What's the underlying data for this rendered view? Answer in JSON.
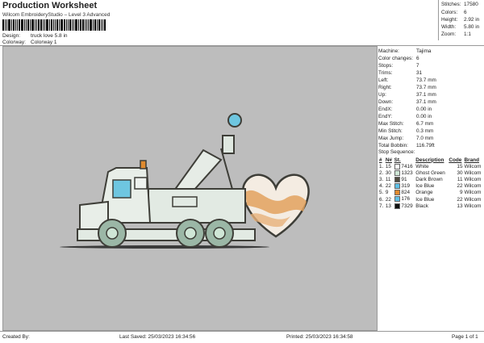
{
  "header": {
    "title": "Production Worksheet",
    "subtitle": "Wilcom EmbroideryStudio – Level 3 Advanced",
    "design_label": "Design:",
    "design_value": "truck love 5.8 in",
    "colorway_label": "Colorway:",
    "colorway_value": "Colorway 1"
  },
  "stats": {
    "stitches_label": "Stitches:",
    "stitches": "17580",
    "colors_label": "Colors:",
    "colors": "6",
    "height_label": "Height:",
    "height": "2.92 in",
    "width_label": "Width:",
    "width": "5.80 in",
    "zoom_label": "Zoom:",
    "zoom": "1:1"
  },
  "machine_info": [
    {
      "k": "Machine:",
      "v": "Tajima"
    },
    {
      "k": "Color changes:",
      "v": "6"
    },
    {
      "k": "Stops:",
      "v": "7"
    },
    {
      "k": "Trims:",
      "v": "31"
    },
    {
      "k": "Left:",
      "v": "73.7 mm"
    },
    {
      "k": "Right:",
      "v": "73.7 mm"
    },
    {
      "k": "Up:",
      "v": "37.1 mm"
    },
    {
      "k": "Down:",
      "v": "37.1 mm"
    },
    {
      "k": "EndX:",
      "v": "0.00 in"
    },
    {
      "k": "EndY:",
      "v": "0.00 in"
    },
    {
      "k": "Max Stitch:",
      "v": "6.7 mm"
    },
    {
      "k": "Min Stitch:",
      "v": "0.3 mm"
    },
    {
      "k": "Max Jump:",
      "v": "7.0 mm"
    },
    {
      "k": "Total Bobbin:",
      "v": "116.79ft"
    }
  ],
  "stop_sequence": {
    "title": "Stop Sequence:",
    "headers": [
      "#",
      "N#",
      "St.",
      "Description",
      "Code",
      "Brand"
    ],
    "rows": [
      {
        "n": "1.",
        "needle": "15",
        "color": "#ffffff",
        "st": "7416",
        "desc": "White",
        "code": "15",
        "brand": "Wilcom"
      },
      {
        "n": "2.",
        "needle": "30",
        "color": "#cfe6d6",
        "st": "1323",
        "desc": "Ghost Green",
        "code": "30",
        "brand": "Wilcom"
      },
      {
        "n": "3.",
        "needle": "11",
        "color": "#4e4a3e",
        "st": "91",
        "desc": "Dark Brown",
        "code": "11",
        "brand": "Wilcom"
      },
      {
        "n": "4.",
        "needle": "22",
        "color": "#5fc0e6",
        "st": "319",
        "desc": "Ice Blue",
        "code": "22",
        "brand": "Wilcom"
      },
      {
        "n": "5.",
        "needle": "9",
        "color": "#e08a2e",
        "st": "824",
        "desc": "Orange",
        "code": "9",
        "brand": "Wilcom"
      },
      {
        "n": "6.",
        "needle": "22",
        "color": "#5fc0e6",
        "st": "176",
        "desc": "Ice Blue",
        "code": "22",
        "brand": "Wilcom"
      },
      {
        "n": "7.",
        "needle": "13",
        "color": "#111111",
        "st": "7329",
        "desc": "Black",
        "code": "13",
        "brand": "Wilcom"
      }
    ]
  },
  "footer": {
    "created": "Created By:",
    "last_saved": "Last Saved: 25/03/2023 16:34:56",
    "printed": "Printed: 25/03/2023 16:34:58",
    "page": "Page 1 of 1"
  }
}
